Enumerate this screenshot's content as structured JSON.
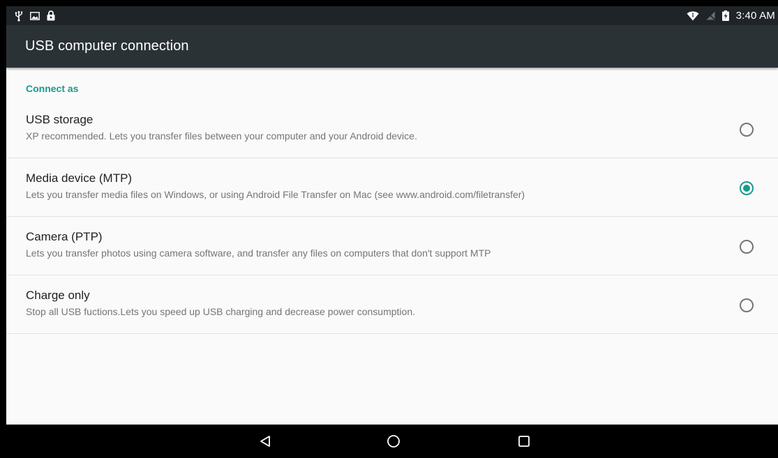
{
  "status_bar": {
    "time": "3:40 AM",
    "left_icons": [
      "usb-icon",
      "image-icon",
      "lock-icon"
    ],
    "right_icons": [
      "wifi-icon",
      "no-signal-icon",
      "battery-charging-icon"
    ]
  },
  "app_bar": {
    "title": "USB computer connection"
  },
  "section": {
    "header": "Connect as"
  },
  "options": [
    {
      "title": "USB storage",
      "description": "XP recommended. Lets you transfer files between your computer and your Android device.",
      "selected": false
    },
    {
      "title": "Media device (MTP)",
      "description": "Lets you transfer media files on Windows, or using Android File Transfer on Mac (see www.android.com/filetransfer)",
      "selected": true
    },
    {
      "title": "Camera (PTP)",
      "description": "Lets you transfer photos using camera software, and transfer any files on computers that don't support MTP",
      "selected": false
    },
    {
      "title": "Charge only",
      "description": "Stop all USB fuctions.Lets you speed up USB charging and decrease power consumption.",
      "selected": false
    }
  ],
  "nav_bar": {
    "buttons": [
      "back-icon",
      "home-icon",
      "recents-icon"
    ]
  },
  "colors": {
    "accent": "#1a9a8a",
    "app_bar": "#2b3236",
    "status_bar": "#1f2428"
  }
}
